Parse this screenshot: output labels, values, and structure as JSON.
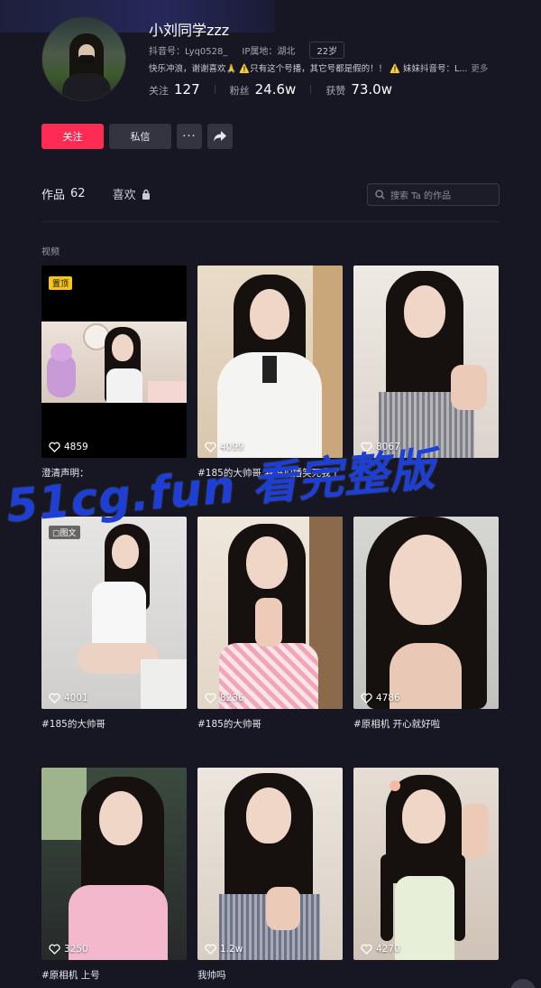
{
  "profile": {
    "name": "小刘同学zzz",
    "douyin_id": "抖音号：Lyq0528_",
    "ip_location": "IP属地：湖北",
    "age": "22岁",
    "bio": "快乐冲浪，谢谢喜欢🙏 ⚠️只有这个号播，其它号都是假的！！ ⚠️ 妹妹抖音号：L...",
    "bio_more": "更多",
    "following_label": "关注",
    "following": "127",
    "followers_label": "粉丝",
    "followers": "24.6w",
    "likes_label": "获赞",
    "likes": "73.0w"
  },
  "actions": {
    "follow": "关注",
    "message": "私信",
    "more": "···"
  },
  "tabs": {
    "works_label": "作品",
    "works_count": "62",
    "liked_label": "喜欢"
  },
  "search": {
    "placeholder": "搜索 Ta 的作品"
  },
  "section": {
    "label": "视频"
  },
  "videos": [
    {
      "likes": "4859",
      "caption": "澄清声明：",
      "badge": "置顶"
    },
    {
      "likes": "4099",
      "caption": "#185的大帅哥 我妈拍播笑死我了"
    },
    {
      "likes": "8067",
      "caption": ""
    },
    {
      "likes": "4001",
      "caption": "#185的大帅哥",
      "badge": "图文"
    },
    {
      "likes": "8236",
      "caption": "#185的大帅哥"
    },
    {
      "likes": "4786",
      "caption": "#原相机 开心就好啦"
    },
    {
      "likes": "3250",
      "caption": "#原相机 上号"
    },
    {
      "likes": "1.2w",
      "caption": "我帅吗"
    },
    {
      "likes": "4270",
      "caption": ""
    }
  ],
  "watermark": "51cg.fun 看完整版",
  "colors": {
    "accent": "#fe2c55",
    "background": "#161722",
    "watermark": "#1d3fd6",
    "pin_badge": "#f5c518"
  },
  "icons": [
    "heart-icon",
    "lock-icon",
    "search-icon",
    "share-icon",
    "more-icon",
    "image-post-icon"
  ]
}
